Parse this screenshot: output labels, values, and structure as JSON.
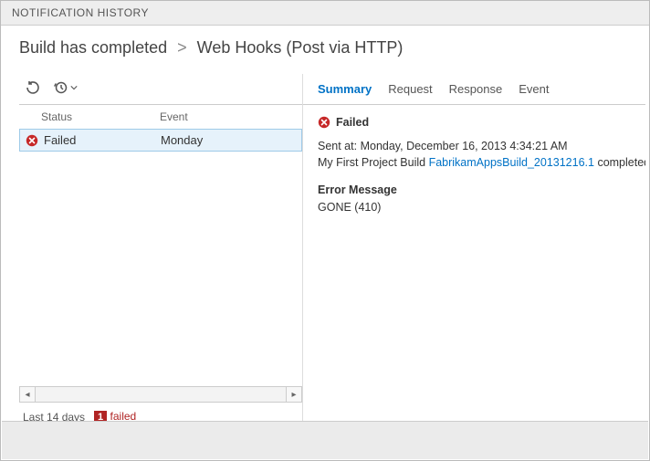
{
  "panel_title": "NOTIFICATION HISTORY",
  "breadcrumb": {
    "part1": "Build has completed",
    "sep": ">",
    "part2": "Web Hooks (Post via HTTP)"
  },
  "grid": {
    "headers": {
      "status": "Status",
      "event": "Event"
    },
    "rows": [
      {
        "status": "Failed",
        "event": "Monday"
      }
    ]
  },
  "footer": {
    "range": "Last 14 days",
    "failed_count": "1",
    "failed_label": "failed"
  },
  "tabs": {
    "summary": "Summary",
    "request": "Request",
    "response": "Response",
    "event": "Event"
  },
  "detail": {
    "status_label": "Failed",
    "sent_at_label": "Sent at:",
    "sent_at_value": "Monday, December 16, 2013 4:34:21 AM",
    "line2_prefix": "My First Project Build",
    "build_link": "FabrikamAppsBuild_20131216.1",
    "line2_suffix": "completed (Status: Successfully Completed)",
    "error_heading": "Error Message",
    "error_body": "GONE (410)"
  },
  "colors": {
    "accent": "#0072c6",
    "error": "#b02424"
  }
}
